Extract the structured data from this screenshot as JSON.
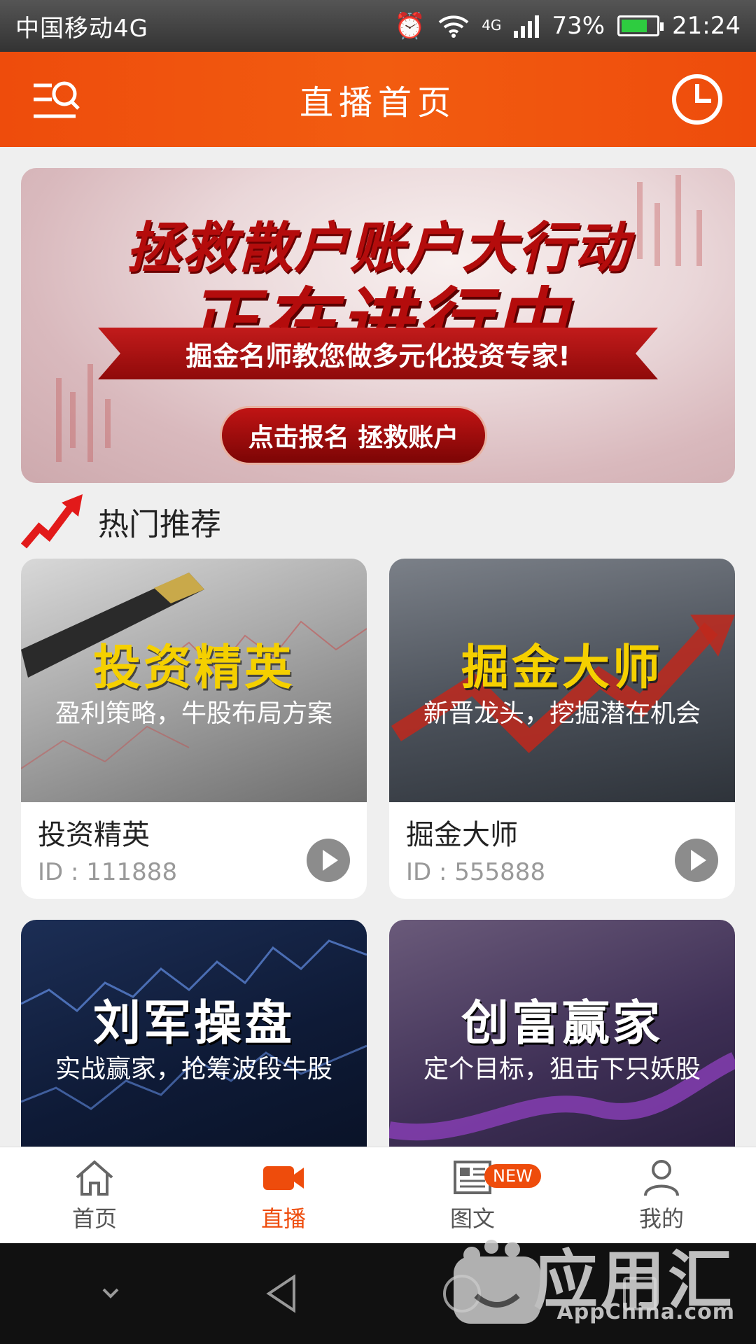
{
  "status_bar": {
    "carrier": "中国移动4G",
    "network": "4G",
    "battery": "73%",
    "time": "21:24"
  },
  "header": {
    "title": "直播首页"
  },
  "banner": {
    "headline": "拯救散户账户大行动",
    "subheadline": "正在进行中",
    "ribbon_text": "掘金名师教您做多元化投资专家!",
    "cta_label": "点击报名 拯救账户"
  },
  "section": {
    "title": "热门推荐"
  },
  "cards": [
    {
      "banner_title": "投资精英",
      "banner_sub": "盈利策略，牛股布局方案",
      "name": "投资精英",
      "id_text": "ID : 111888",
      "accent": "#f5d000"
    },
    {
      "banner_title": "掘金大师",
      "banner_sub": "新晋龙头，挖掘潜在机会",
      "name": "掘金大师",
      "id_text": "ID : 555888",
      "accent": "#f5d000"
    },
    {
      "banner_title": "刘军操盘",
      "banner_sub": "实战赢家，抢筹波段牛股",
      "accent": "#ffffff"
    },
    {
      "banner_title": "创富赢家",
      "banner_sub": "定个目标，狙击下只妖股",
      "accent": "#ffffff"
    }
  ],
  "tabs": [
    {
      "label": "首页",
      "icon": "home-icon"
    },
    {
      "label": "直播",
      "icon": "video-camera-icon",
      "active": true
    },
    {
      "label": "图文",
      "icon": "news-icon",
      "badge": "NEW"
    },
    {
      "label": "我的",
      "icon": "user-icon"
    }
  ],
  "watermark": {
    "title": "应用汇",
    "subtitle": "AppChina.com"
  },
  "colors": {
    "brand": "#ee4c0c",
    "background": "#efefef"
  }
}
